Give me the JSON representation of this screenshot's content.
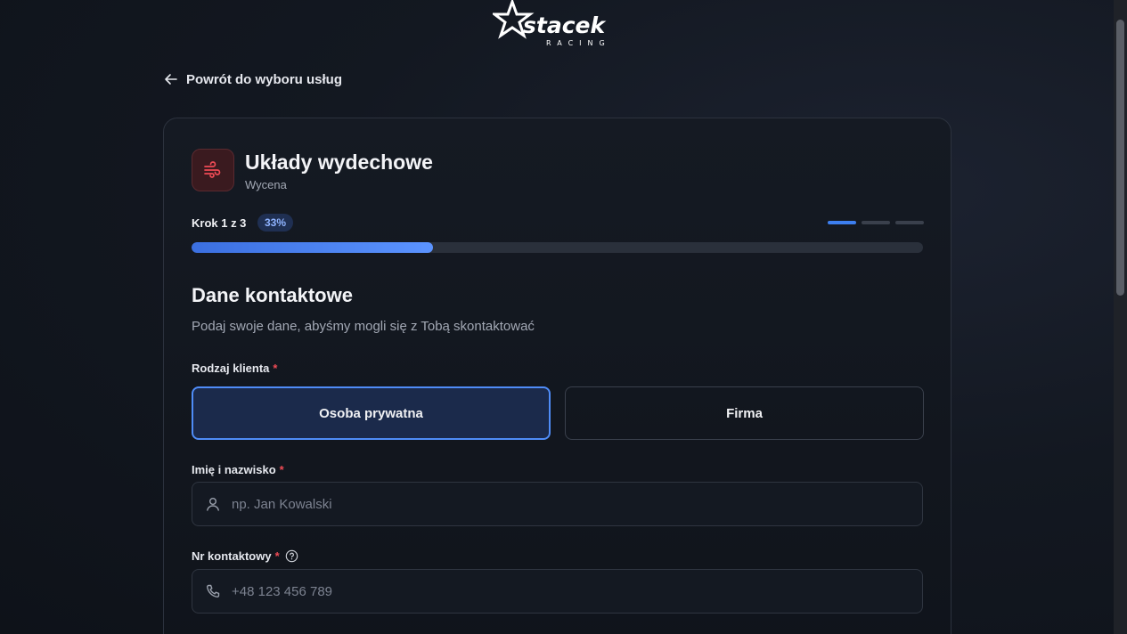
{
  "brand": {
    "logo_text": "stacek",
    "logo_sub": "RACING"
  },
  "nav": {
    "back_label": "Powrót do wyboru usług"
  },
  "service": {
    "title": "Układy wydechowe",
    "subtitle": "Wycena",
    "icon": "exhaust-wind-icon"
  },
  "progress": {
    "step_label": "Krok 1 z 3",
    "percent_label": "33%",
    "fraction": 0.33,
    "current_step": 1,
    "total_steps": 3
  },
  "form": {
    "title": "Dane kontaktowe",
    "subtitle": "Podaj swoje dane, abyśmy mogli się z Tobą skontaktować",
    "client_type": {
      "label": "Rodzaj klienta",
      "required_mark": "*",
      "options": [
        {
          "label": "Osoba prywatna",
          "selected": true
        },
        {
          "label": "Firma",
          "selected": false
        }
      ]
    },
    "name": {
      "label": "Imię i nazwisko",
      "required_mark": "*",
      "placeholder": "np. Jan Kowalski",
      "value": ""
    },
    "phone": {
      "label": "Nr kontaktowy",
      "required_mark": "*",
      "placeholder": "+48 123 456 789",
      "value": ""
    }
  },
  "colors": {
    "accent": "#3d7ff0",
    "required": "#ef4b55",
    "icon_red": "#ef4b55"
  }
}
